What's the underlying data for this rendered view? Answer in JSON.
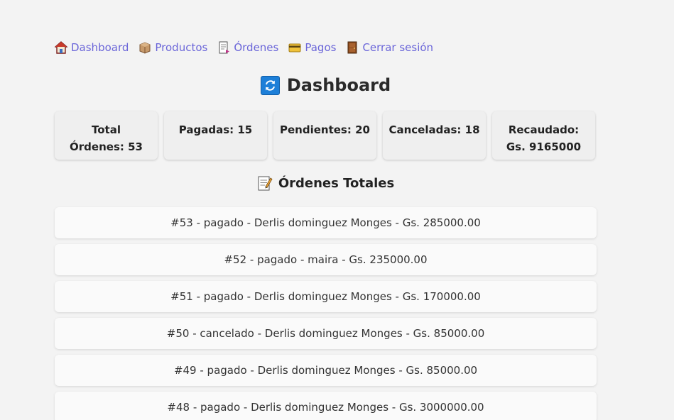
{
  "nav": [
    {
      "label": "Dashboard",
      "icon": "house-icon"
    },
    {
      "label": "Productos",
      "icon": "box-icon"
    },
    {
      "label": "Órdenes",
      "icon": "document-icon"
    },
    {
      "label": "Pagos",
      "icon": "credit-card-icon"
    },
    {
      "label": "Cerrar sesión",
      "icon": "door-icon"
    }
  ],
  "header": {
    "title": "Dashboard",
    "icon": "refresh-icon"
  },
  "stats": [
    {
      "label": "Total Órdenes: 53"
    },
    {
      "label": "Pagadas: 15"
    },
    {
      "label": "Pendientes: 20"
    },
    {
      "label": "Canceladas: 18"
    },
    {
      "label": "Recaudado: Gs. 9165000"
    }
  ],
  "orders_section": {
    "title": "Órdenes Totales",
    "icon": "memo-icon"
  },
  "orders": [
    {
      "text": "#53 - pagado - Derlis dominguez Monges - Gs. 285000.00"
    },
    {
      "text": "#52 - pagado - maira - Gs. 235000.00"
    },
    {
      "text": "#51 - pagado - Derlis dominguez Monges - Gs. 170000.00"
    },
    {
      "text": "#50 - cancelado - Derlis dominguez Monges - Gs. 85000.00"
    },
    {
      "text": "#49 - pagado - Derlis dominguez Monges - Gs. 85000.00"
    },
    {
      "text": "#48 - pagado - Derlis dominguez Monges - Gs. 3000000.00"
    }
  ],
  "colors": {
    "link": "#6b66d9",
    "background": "#f3f3f3",
    "card": "#efefef",
    "row": "#fafafa"
  }
}
